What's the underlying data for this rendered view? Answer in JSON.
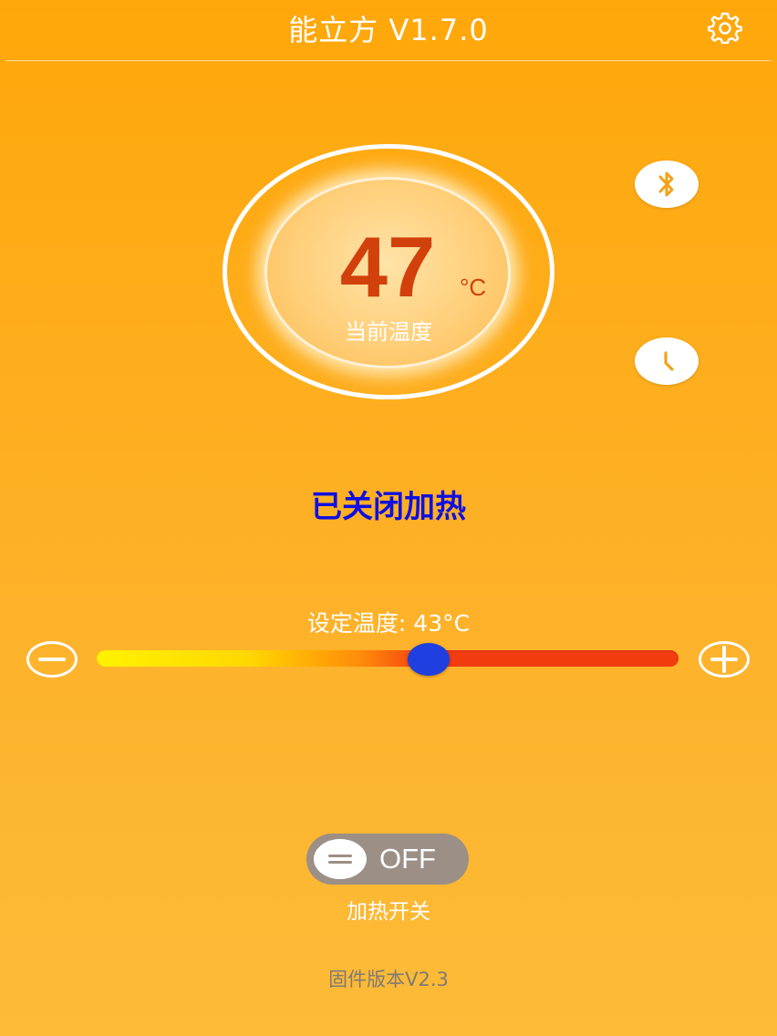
{
  "header": {
    "title": "能立方 V1.7.0",
    "settings_icon": "gear-icon"
  },
  "current_temp": {
    "value": "47",
    "unit": "°C",
    "label": "当前温度"
  },
  "side_buttons": {
    "bluetooth_icon": "bluetooth-icon",
    "timer_icon": "clock-icon"
  },
  "heating_status": "已关闭加热",
  "set_temp": {
    "label": "设定温度: 43°C",
    "value": 43,
    "slider_fraction": 0.57
  },
  "heating_switch": {
    "state": "OFF",
    "label": "加热开关"
  },
  "firmware": "固件版本V2.3",
  "colors": {
    "background": "#FFA70A",
    "current_temp": "#D2400C",
    "status_text": "#1010E0",
    "slider_thumb": "#1F3FE0",
    "toggle_off": "#9C8F86"
  }
}
